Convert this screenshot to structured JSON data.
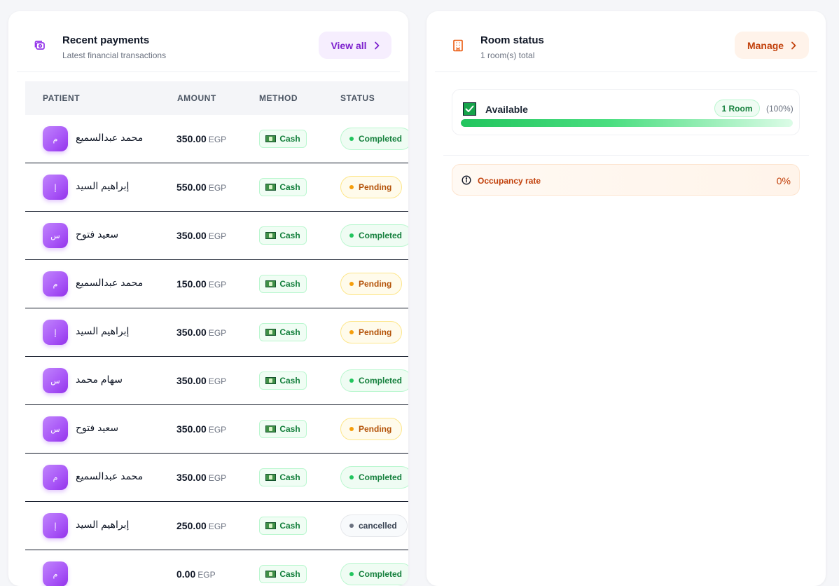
{
  "payments": {
    "title": "Recent payments",
    "subtitle": "Latest financial transactions",
    "view_all_label": "View all",
    "columns": [
      "PATIENT",
      "AMOUNT",
      "METHOD",
      "STATUS"
    ],
    "rows": [
      {
        "initial": "م",
        "name": "محمد عبدالسميع",
        "amount": "350.00",
        "currency": "EGP",
        "method": "Cash",
        "status": "Completed",
        "status_type": "completed"
      },
      {
        "initial": "إ",
        "name": "إبراهيم السيد",
        "amount": "550.00",
        "currency": "EGP",
        "method": "Cash",
        "status": "Pending",
        "status_type": "pending"
      },
      {
        "initial": "س",
        "name": "سعيد فتوح",
        "amount": "350.00",
        "currency": "EGP",
        "method": "Cash",
        "status": "Completed",
        "status_type": "completed"
      },
      {
        "initial": "م",
        "name": "محمد عبدالسميع",
        "amount": "150.00",
        "currency": "EGP",
        "method": "Cash",
        "status": "Pending",
        "status_type": "pending"
      },
      {
        "initial": "إ",
        "name": "إبراهيم السيد",
        "amount": "350.00",
        "currency": "EGP",
        "method": "Cash",
        "status": "Pending",
        "status_type": "pending"
      },
      {
        "initial": "س",
        "name": "سهام محمد",
        "amount": "350.00",
        "currency": "EGP",
        "method": "Cash",
        "status": "Completed",
        "status_type": "completed"
      },
      {
        "initial": "س",
        "name": "سعيد فتوح",
        "amount": "350.00",
        "currency": "EGP",
        "method": "Cash",
        "status": "Pending",
        "status_type": "pending"
      },
      {
        "initial": "م",
        "name": "محمد عبدالسميع",
        "amount": "350.00",
        "currency": "EGP",
        "method": "Cash",
        "status": "Completed",
        "status_type": "completed"
      },
      {
        "initial": "إ",
        "name": "إبراهيم السيد",
        "amount": "250.00",
        "currency": "EGP",
        "method": "Cash",
        "status": "cancelled",
        "status_type": "cancelled"
      },
      {
        "initial": "م",
        "name": "",
        "amount": "0.00",
        "currency": "EGP",
        "method": "Cash",
        "status": "Completed",
        "status_type": "completed"
      }
    ]
  },
  "rooms": {
    "title": "Room status",
    "subtitle": "1 room(s) total",
    "manage_label": "Manage",
    "available": {
      "label": "Available",
      "count_label": "1 Room",
      "percent_label": "(100%)",
      "fraction": 1.0
    },
    "occupancy": {
      "label": "Occupancy rate",
      "value": "0%"
    }
  },
  "colors": {
    "accent_purple": "#7e22ce",
    "accent_orange": "#c2410c",
    "success": "#15803d",
    "warning": "#b45309"
  },
  "icons": {
    "payments_header": "camera-money-icon",
    "rooms_header": "building-icon",
    "chevron": "chevron-right-icon",
    "method": "banknote-icon",
    "available": "check-box-icon",
    "info": "info-circle-icon"
  }
}
